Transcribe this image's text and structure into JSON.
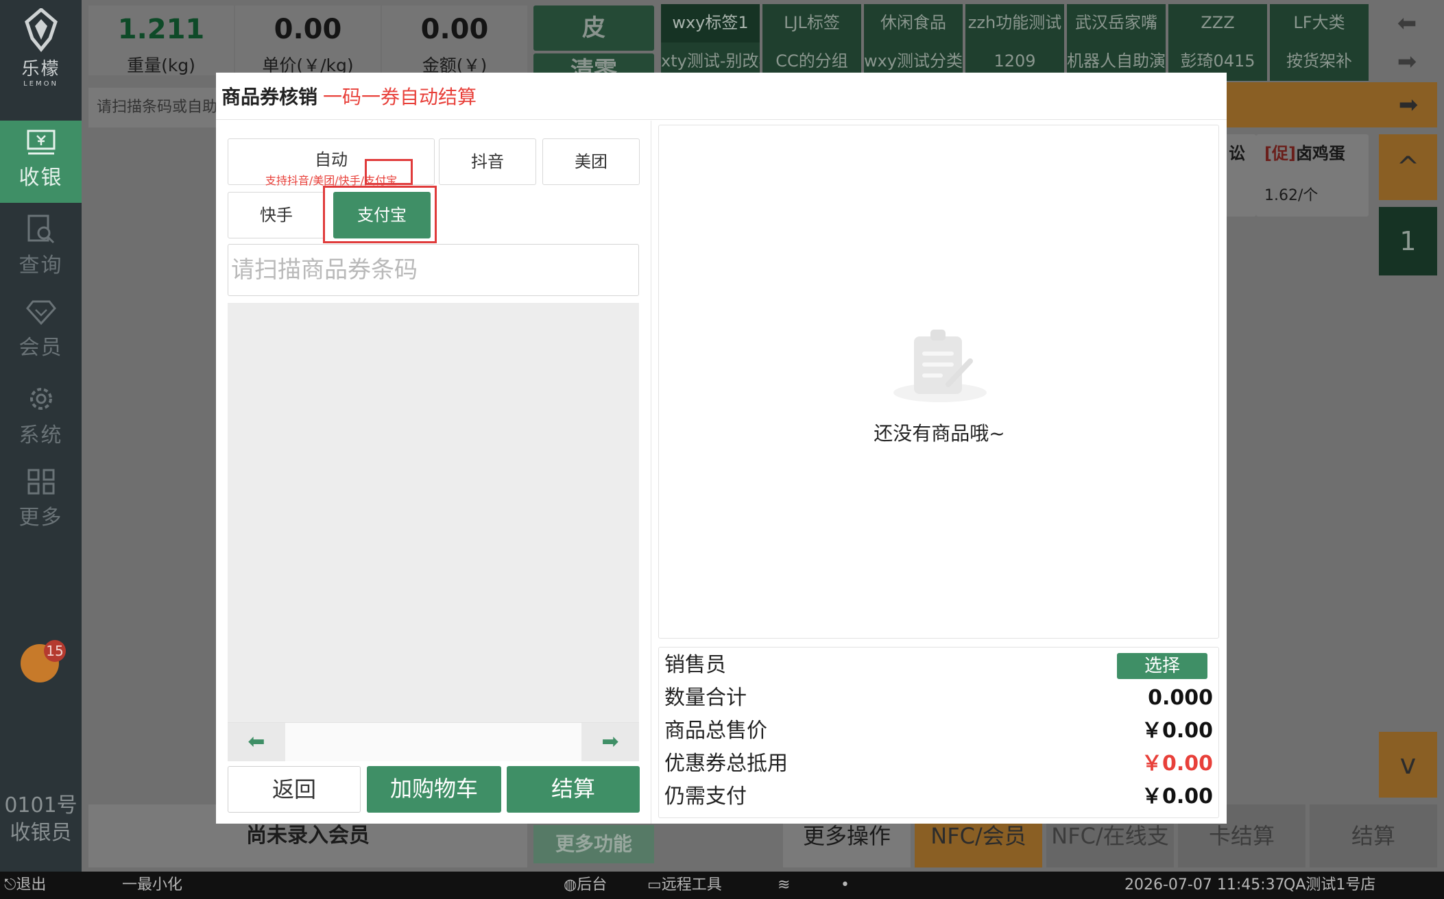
{
  "brand": {
    "name": "乐檬",
    "sub": "LEMON"
  },
  "sidebar": {
    "items": [
      {
        "label": "收银",
        "icon": "cash-register-icon"
      },
      {
        "label": "查询",
        "icon": "search-doc-icon"
      },
      {
        "label": "会员",
        "icon": "diamond-icon"
      },
      {
        "label": "系统",
        "icon": "gear-icon"
      },
      {
        "label": "更多",
        "icon": "grid-icon"
      }
    ],
    "notification_count": "15",
    "cashier_line1": "0101号",
    "cashier_line2": "收银员"
  },
  "scale": {
    "weight_value": "1.211",
    "weight_label": "重量(kg)",
    "unit_price_value": "0.00",
    "unit_price_label": "单价(￥/kg)",
    "amount_value": "0.00",
    "amount_label": "金额(￥)"
  },
  "top_buttons": {
    "tare": "皮",
    "clear": "清零"
  },
  "categories": {
    "row1": [
      "wxy标签1",
      "LJL标签",
      "休闲食品",
      "zzh功能测试",
      "武汉岳家嘴",
      "ZZZ",
      "LF大类"
    ],
    "row2": [
      "xty测试-别改我商品",
      "CC的分组",
      "wxy测试分类",
      "1209",
      "机器人自助演示",
      "彭琦0415",
      "按货架补"
    ]
  },
  "scan_placeholder": "请扫描条码或自助",
  "products": [
    {
      "name_suffix": "讼",
      "promo": "",
      "price": ""
    },
    {
      "promo": "[促]",
      "name": "卤鸡蛋",
      "price": "1.62/个"
    }
  ],
  "paging": {
    "up": "^",
    "page": "1",
    "down": "v"
  },
  "bottom": {
    "member_status": "尚未录入会员",
    "more_functions": "更多功能",
    "more_ops": "更多操作",
    "nfc_member": "NFC/会员",
    "nfc_online": "NFC/在线支付",
    "card_settle": "卡结算",
    "settle": "结算"
  },
  "statusbar": {
    "exit": "退出",
    "minimize": "一最小化",
    "backend": "后台",
    "remote": "远程工具",
    "datetime": "2026-07-07 11:45:37",
    "store": "QA测试1号店"
  },
  "modal": {
    "title": "商品券核销",
    "subtitle": "一码一券自动结算",
    "types": {
      "auto": "自动",
      "auto_hint": "支持抖音/美团/快手/支付宝",
      "douyin": "抖音",
      "meituan": "美团",
      "kuaishou": "快手",
      "alipay": "支付宝"
    },
    "selected_type": "支付宝",
    "coupon_placeholder": "请扫描商品券条码",
    "buttons": {
      "back": "返回",
      "add_cart": "加购物车",
      "settle": "结算"
    },
    "empty_text": "还没有商品哦~",
    "summary": {
      "salesperson_label": "销售员",
      "choose": "选择",
      "qty_label": "数量合计",
      "qty_value": "0.000",
      "total_label": "商品总售价",
      "total_value": "￥0.00",
      "coupon_label": "优惠券总抵用",
      "coupon_value": "￥0.00",
      "due_label": "仍需支付",
      "due_value": "￥0.00"
    }
  },
  "colors": {
    "primary_green": "#3f8f66",
    "accent_red": "#e8403a",
    "accent_orange": "#e8952f",
    "sidebar_bg": "#2b3438"
  }
}
